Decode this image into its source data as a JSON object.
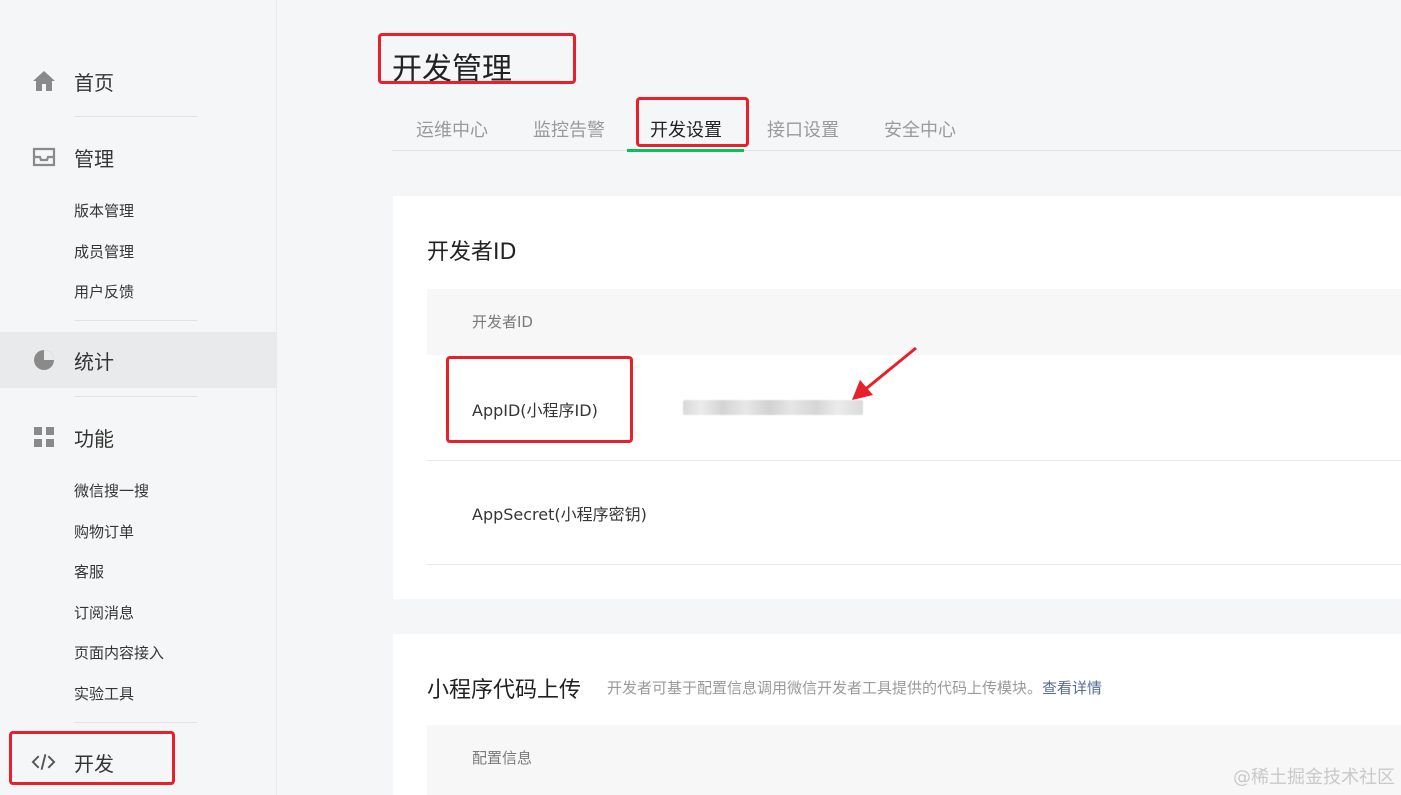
{
  "sidebar": {
    "home_label": "首页",
    "manage_label": "管理",
    "manage_items": [
      "版本管理",
      "成员管理",
      "用户反馈"
    ],
    "stats_label": "统计",
    "features_label": "功能",
    "features_items": [
      "微信搜一搜",
      "购物订单",
      "客服",
      "订阅消息",
      "页面内容接入",
      "实验工具"
    ],
    "dev_label": "开发"
  },
  "header": {
    "title": "开发管理"
  },
  "tabs": [
    "运维中心",
    "监控告警",
    "开发设置",
    "接口设置",
    "安全中心"
  ],
  "active_tab": "开发设置",
  "dev_id_card": {
    "title": "开发者ID",
    "table_header": "开发者ID",
    "appid_label": "AppID(小程序ID)",
    "appsecret_label": "AppSecret(小程序密钥)"
  },
  "upload_card": {
    "title": "小程序代码上传",
    "description": "开发者可基于配置信息调用微信开发者工具提供的代码上传模块。",
    "link": "查看详情",
    "table_header": "配置信息"
  },
  "watermark": "@稀土掘金技术社区",
  "colors": {
    "accent": "#07c160",
    "annotation": "#e8202a",
    "link": "#576b95"
  }
}
